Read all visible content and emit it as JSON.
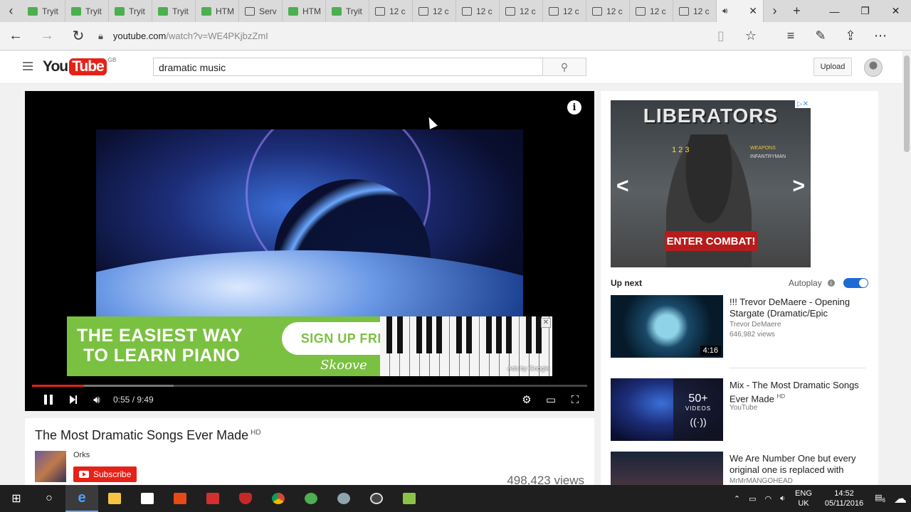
{
  "browser": {
    "tabs": [
      {
        "label": "Tryit",
        "icon": "w3-icon"
      },
      {
        "label": "Tryit",
        "icon": "w3-icon"
      },
      {
        "label": "Tryit",
        "icon": "w3-icon"
      },
      {
        "label": "Tryit",
        "icon": "w3-icon"
      },
      {
        "label": "HTM",
        "icon": "w3-icon"
      },
      {
        "label": "Serv",
        "icon": "page-icon"
      },
      {
        "label": "HTM",
        "icon": "w3-icon"
      },
      {
        "label": "Tryit",
        "icon": "w3-icon"
      },
      {
        "label": "12 c",
        "icon": "page-icon"
      },
      {
        "label": "12 c",
        "icon": "page-icon"
      },
      {
        "label": "12 c",
        "icon": "page-icon"
      },
      {
        "label": "12 c",
        "icon": "page-icon"
      },
      {
        "label": "12 c",
        "icon": "page-icon"
      },
      {
        "label": "12 c",
        "icon": "page-icon"
      },
      {
        "label": "12 c",
        "icon": "page-icon"
      },
      {
        "label": "12 c",
        "icon": "page-icon"
      }
    ],
    "active_tab_close": "✕",
    "url_host": "youtube.com",
    "url_path": "/watch?v=WE4PKjbzZmI"
  },
  "youtube": {
    "logo_you": "You",
    "logo_tube": "Tube",
    "logo_region": "GB",
    "search_value": "dramatic music",
    "upload_label": "Upload",
    "player": {
      "time_current": "0:55",
      "time_total": "9:49",
      "time_display": "0:55 / 9:49",
      "played_fraction": 0.093,
      "loaded_fraction": 0.255,
      "overlay_ad": {
        "line1": "THE EASIEST WAY",
        "line2": "TO LEARN PIANO",
        "cta": "SIGN UP FREE ▶",
        "brand": "Skoove",
        "ads_by": "Ads by Google"
      }
    },
    "video": {
      "title": "The Most Dramatic Songs Ever Made",
      "hd_badge": "HD",
      "channel": "Orks",
      "subscribe_label": "Subscribe",
      "views": "498,423 views"
    },
    "side_ad": {
      "headline": "LIBERATORS",
      "button": "ENTER COMBAT!",
      "weapons_label": "WEAPONS",
      "infantry_label": "INFANTRYMAN",
      "nums": "1 2 3"
    },
    "up_next_label": "Up next",
    "autoplay_label": "Autoplay",
    "recommendations": [
      {
        "title": "!!! Trevor DeMaere - Opening Stargate (Dramatic/Epic",
        "channel": "Trevor DeMaere",
        "views": "646,982 views",
        "duration": "4:16"
      },
      {
        "title": "Mix - The Most Dramatic Songs Ever Made",
        "hd": "HD",
        "channel": "YouTube",
        "playlist_count": "50+",
        "playlist_label": "VIDEOS"
      },
      {
        "title": "We Are Number One but every original one is replaced with",
        "channel": "MrMrMANGOHEAD"
      }
    ]
  },
  "taskbar": {
    "lang_top": "ENG",
    "lang_bottom": "UK",
    "time": "14:52",
    "date": "05/11/2016",
    "notification_count": "6"
  }
}
